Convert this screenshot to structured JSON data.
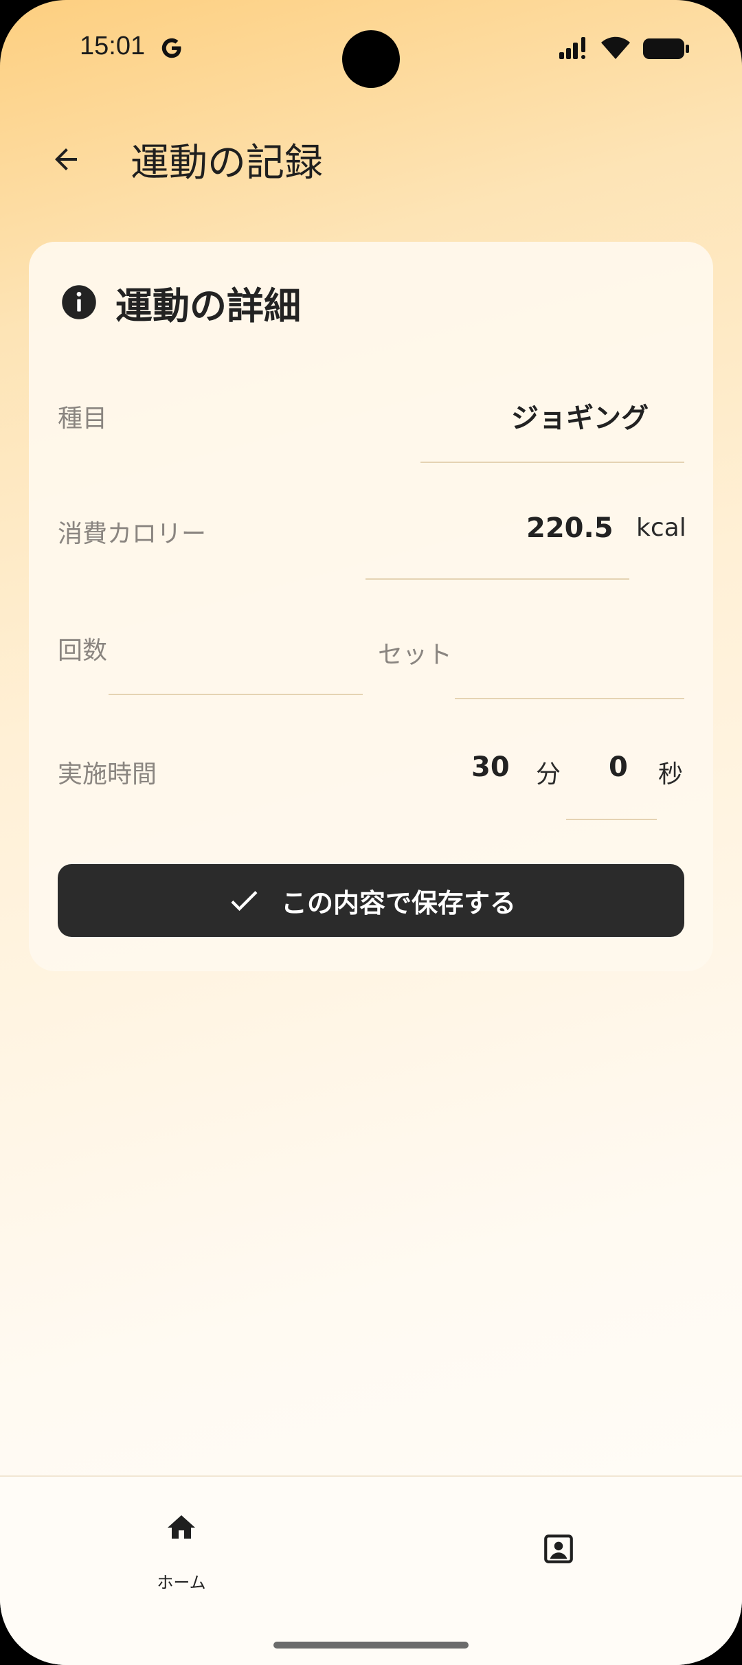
{
  "status_bar": {
    "time": "15:01"
  },
  "header": {
    "title": "運動の記録"
  },
  "card": {
    "title": "運動の詳細",
    "fields": {
      "exercise_label": "種目",
      "exercise_value": "ジョギング",
      "calories_label": "消費カロリー",
      "calories_value": "220.5",
      "calories_unit": "kcal",
      "reps_label": "回数",
      "reps_value": "",
      "sets_label": "セット",
      "sets_value": "",
      "duration_label": "実施時間",
      "minutes_value": "30",
      "minutes_unit": "分",
      "seconds_value": "0",
      "seconds_unit": "秒"
    },
    "save_button": "この内容で保存する"
  },
  "bottom_nav": {
    "home_label": "ホーム",
    "profile_icon": "account-box-icon"
  }
}
